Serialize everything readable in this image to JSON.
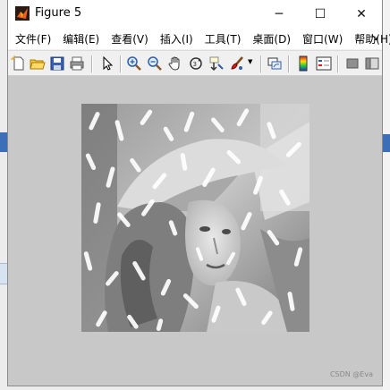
{
  "window": {
    "title": "Figure 5",
    "controls": {
      "minimize": "─",
      "maximize": "☐",
      "close": "✕"
    }
  },
  "menubar": {
    "items": [
      {
        "label": "文件(F)"
      },
      {
        "label": "编辑(E)"
      },
      {
        "label": "查看(V)"
      },
      {
        "label": "插入(I)"
      },
      {
        "label": "工具(T)"
      },
      {
        "label": "桌面(D)"
      },
      {
        "label": "窗口(W)"
      },
      {
        "label": "帮助(H)"
      }
    ],
    "overflow": "↘"
  },
  "toolbar": {
    "icons": [
      "new-figure-icon",
      "open-file-icon",
      "save-icon",
      "print-icon",
      "select-arrow-icon",
      "zoom-in-icon",
      "zoom-out-icon",
      "pan-hand-icon",
      "rotate-3d-icon",
      "data-cursor-icon",
      "brush-icon",
      "brush-dropdown-icon",
      "link-plot-icon",
      "colorbar-icon",
      "legend-icon",
      "hide-plot-tools-icon",
      "show-plot-tools-icon"
    ]
  },
  "figure": {
    "image": "grayscale-portrait-with-salt-noise",
    "watermark": "CSDN @Eva"
  }
}
